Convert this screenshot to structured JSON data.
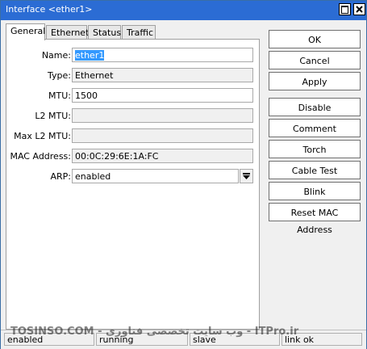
{
  "window": {
    "title": "Interface <ether1>"
  },
  "tabs": [
    {
      "label": "General",
      "active": true
    },
    {
      "label": "Ethernet",
      "active": false
    },
    {
      "label": "Status",
      "active": false
    },
    {
      "label": "Traffic",
      "active": false
    }
  ],
  "form": {
    "name": {
      "label": "Name:",
      "value": "ether1"
    },
    "type": {
      "label": "Type:",
      "value": "Ethernet"
    },
    "mtu": {
      "label": "MTU:",
      "value": "1500"
    },
    "l2mtu": {
      "label": "L2 MTU:",
      "value": ""
    },
    "maxl2mtu": {
      "label": "Max L2 MTU:",
      "value": ""
    },
    "mac": {
      "label": "MAC Address:",
      "value": "00:0C:29:6E:1A:FC"
    },
    "arp": {
      "label": "ARP:",
      "value": "enabled"
    }
  },
  "buttons": {
    "ok": "OK",
    "cancel": "Cancel",
    "apply": "Apply",
    "disable": "Disable",
    "comment": "Comment",
    "torch": "Torch",
    "cable_test": "Cable Test",
    "blink": "Blink",
    "reset_mac": "Reset MAC Address"
  },
  "status": {
    "enabled": "enabled",
    "running": "running",
    "slave": "slave",
    "link": "link ok"
  },
  "watermark": "TOSINSO.COM - وب سایت تخصصی فناوری - ITPro.ir",
  "colors": {
    "titlebar": "#2b6cd4",
    "selection": "#3399ff"
  }
}
